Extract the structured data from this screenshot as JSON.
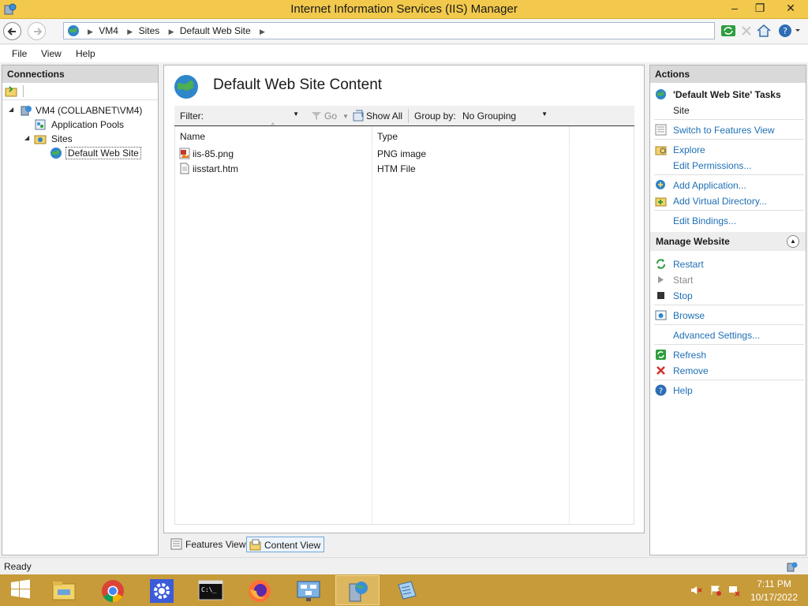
{
  "window": {
    "title": "Internet Information Services (IIS) Manager",
    "minimize": "–",
    "restore": "❐",
    "close": "✕"
  },
  "address": {
    "crumbs": [
      "VM4",
      "Sites",
      "Default Web Site"
    ]
  },
  "menu": [
    "File",
    "View",
    "Help"
  ],
  "connections": {
    "header": "Connections",
    "tree": [
      {
        "label": "VM4 (COLLABNET\\VM4)",
        "icon": "server-icon"
      },
      {
        "label": "Application Pools",
        "icon": "app-pools-icon"
      },
      {
        "label": "Sites",
        "icon": "sites-folder-icon"
      },
      {
        "label": "Default Web Site",
        "icon": "globe-icon"
      }
    ]
  },
  "content": {
    "title": "Default Web Site Content",
    "filter_label": "Filter:",
    "filter_value": "",
    "go_label": "Go",
    "show_all_label": "Show All",
    "group_by_label": "Group by:",
    "group_by_value": "No Grouping",
    "columns": [
      "Name",
      "Type"
    ],
    "rows": [
      {
        "name": "iis-85.png",
        "type": "PNG image",
        "icon": "image-file-icon"
      },
      {
        "name": "iisstart.htm",
        "type": "HTM File",
        "icon": "document-icon"
      }
    ]
  },
  "view_tabs": {
    "features": "Features View",
    "content": "Content View"
  },
  "actions": {
    "header": "Actions",
    "tasks_title": "'Default Web Site' Tasks",
    "tasks_subtitle": "Site",
    "switch_features": "Switch to Features View",
    "explore": "Explore",
    "edit_permissions": "Edit Permissions...",
    "add_application": "Add Application...",
    "add_virtual_directory": "Add Virtual Directory...",
    "edit_bindings": "Edit Bindings...",
    "manage_website": "Manage Website",
    "restart": "Restart",
    "start": "Start",
    "stop": "Stop",
    "browse": "Browse",
    "advanced_settings": "Advanced Settings...",
    "refresh": "Refresh",
    "remove": "Remove",
    "help": "Help"
  },
  "status": {
    "text": "Ready"
  },
  "taskbar": {
    "time": "7:11 PM",
    "date": "10/17/2022"
  },
  "colors": {
    "titlebar": "#f2c94c",
    "taskbar": "#c79a3a",
    "link": "#1e6fb5"
  }
}
